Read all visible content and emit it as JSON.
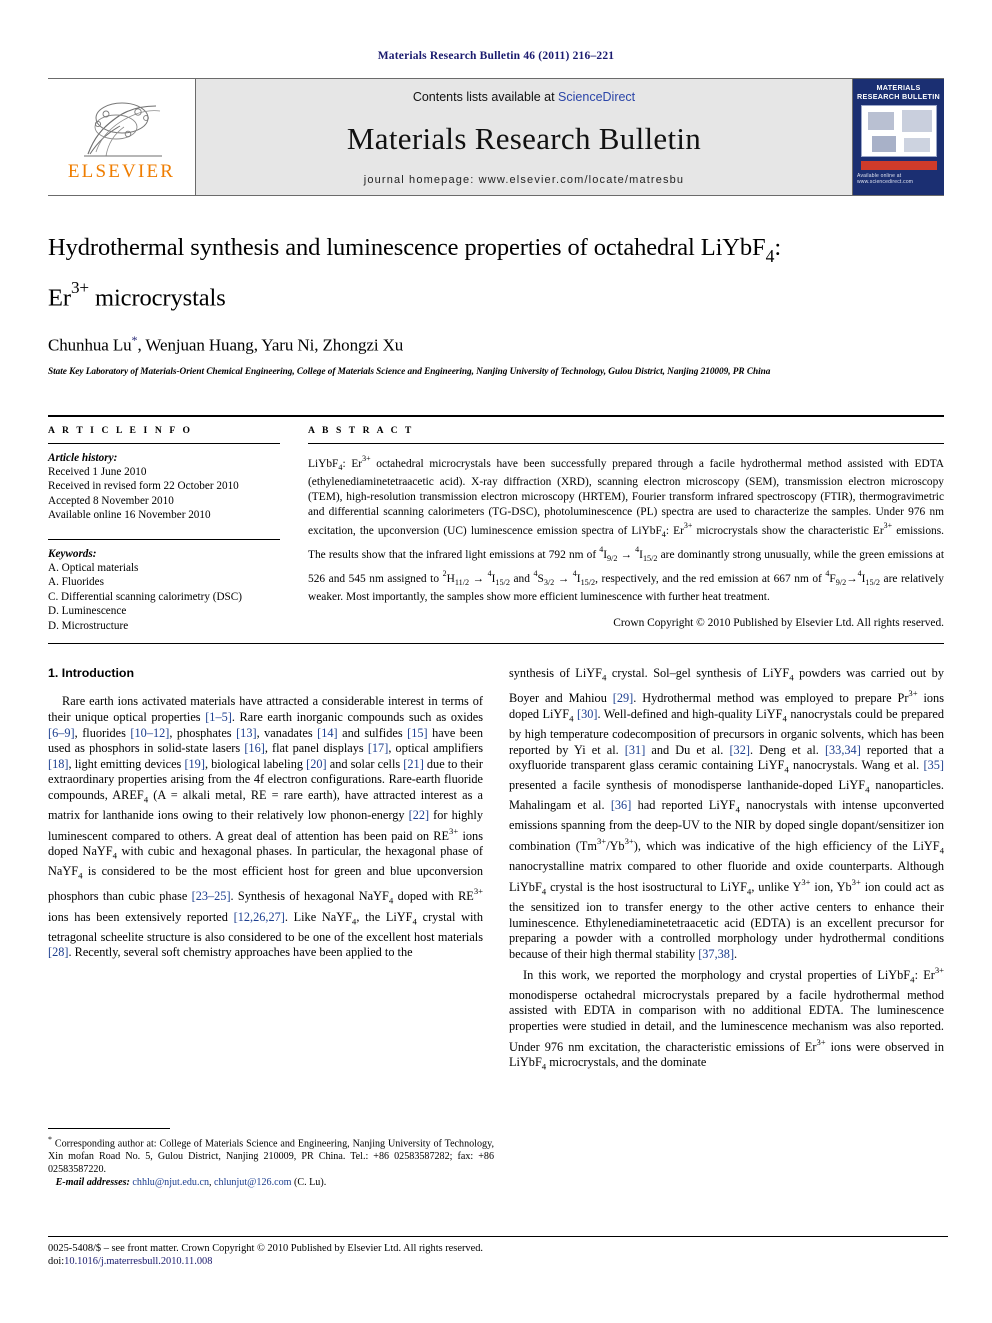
{
  "running_head": "Materials Research Bulletin 46 (2011) 216–221",
  "masthead": {
    "contents_prefix": "Contents lists available at ",
    "contents_link": "ScienceDirect",
    "journal_name": "Materials Research Bulletin",
    "homepage": "journal homepage: www.elsevier.com/locate/matresbu",
    "publisher_wordmark": "ELSEVIER",
    "cover_title": "MATERIALS RESEARCH BULLETIN",
    "cover_footer": "Available online at www.sciencedirect.com",
    "link_color": "#2b45a8",
    "brand_orange": "#ef7d00",
    "cover_navy": "#1b2f72"
  },
  "article": {
    "title_line1": "Hydrothermal synthesis and luminescence properties of octahedral LiYbF",
    "title_sub1": "4",
    "title_colon": ":",
    "title_line2_a": "Er",
    "title_line2_sup": "3+",
    "title_line2_b": " microcrystals",
    "authors": "Chunhua Lu",
    "authors_rest": ", Wenjuan Huang, Yaru Ni, Zhongzi Xu",
    "affiliation": "State Key Laboratory of Materials-Orient Chemical Engineering, College of Materials Science and Engineering, Nanjing University of Technology, Gulou District, Nanjing 210009, PR China"
  },
  "info": {
    "heading": "A R T I C L E   I N F O",
    "history_label": "Article history:",
    "history": [
      "Received 1 June 2010",
      "Received in revised form 22 October 2010",
      "Accepted 8 November 2010",
      "Available online 16 November 2010"
    ],
    "keywords_label": "Keywords:",
    "keywords": [
      "A. Optical materials",
      "A. Fluorides",
      "C. Differential scanning calorimetry (DSC)",
      "D. Luminescence",
      "D. Microstructure"
    ]
  },
  "abstract": {
    "heading": "A B S T R A C T",
    "copyright": "Crown Copyright © 2010 Published by Elsevier Ltd. All rights reserved."
  },
  "body": {
    "section1_title": "1. Introduction"
  },
  "footnote": {
    "corresponding": "Corresponding author at: College of Materials Science and Engineering, Nanjing University of Technology, Xin mofan Road No. 5, Gulou District, Nanjing 210009, PR China. Tel.: +86 02583587282; fax: +86 02583587220.",
    "email_label": "E-mail addresses:",
    "email1": "chhlu@njut.edu.cn",
    "email2": "chlunjut@126.com",
    "email_suffix": " (C. Lu)."
  },
  "page_footer": {
    "issn_line": "0025-5408/$ – see front matter. Crown Copyright © 2010 Published by Elsevier Ltd. All rights reserved.",
    "doi_label": "doi:",
    "doi_value": "10.1016/j.materresbull.2010.11.008"
  }
}
